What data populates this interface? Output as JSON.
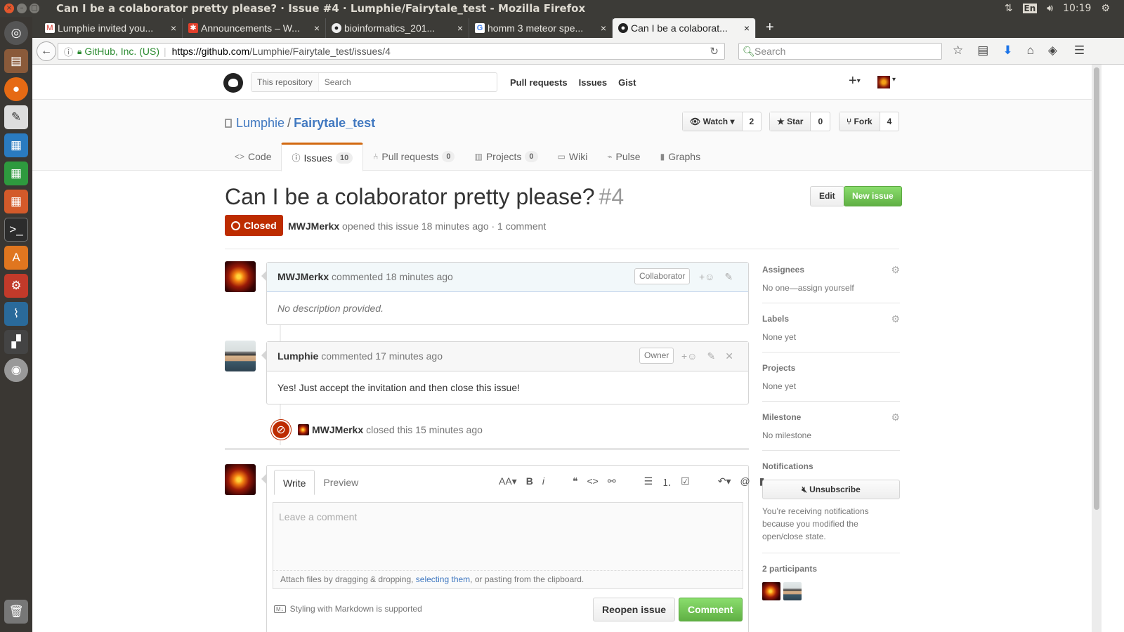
{
  "window": {
    "title": "Can I be a colaborator pretty please? · Issue #4 · Lumphie/Fairytale_test - Mozilla Firefox",
    "tray_lang": "En",
    "time": "10:19"
  },
  "tabs": [
    {
      "label": "Lumphie invited you...",
      "favicon": "gmail-icon"
    },
    {
      "label": "Announcements – W...",
      "favicon": "canvas-icon"
    },
    {
      "label": "bioinformatics_201...",
      "favicon": "github-icon"
    },
    {
      "label": "homm 3 meteor spe...",
      "favicon": "google-icon"
    },
    {
      "label": "Can I be a colaborat...",
      "favicon": "github-icon",
      "active": true
    }
  ],
  "navbar": {
    "identity": "GitHub, Inc. (US)",
    "url_prefix": "https://github.com",
    "url_path": "/Lumphie/Fairytale_test/issues/4",
    "search_placeholder": "Search"
  },
  "gh_header": {
    "scope": "This repository",
    "search_placeholder": "Search",
    "nav": [
      "Pull requests",
      "Issues",
      "Gist"
    ],
    "plus": "+"
  },
  "repo": {
    "owner": "Lumphie",
    "name": "Fairytale_test",
    "watch_label": "Watch",
    "watch_count": "2",
    "star_label": "Star",
    "star_count": "0",
    "fork_label": "Fork",
    "fork_count": "4",
    "tabs": [
      {
        "label": "Code",
        "icon": "code-icon"
      },
      {
        "label": "Issues",
        "count": "10",
        "icon": "issue-opened-icon"
      },
      {
        "label": "Pull requests",
        "count": "0",
        "icon": "git-pull-request-icon"
      },
      {
        "label": "Projects",
        "count": "0",
        "icon": "project-icon"
      },
      {
        "label": "Wiki",
        "icon": "book-icon"
      },
      {
        "label": "Pulse",
        "icon": "pulse-icon"
      },
      {
        "label": "Graphs",
        "icon": "graph-icon"
      }
    ]
  },
  "issue": {
    "title": "Can I be a colaborator pretty please?",
    "number": "#4",
    "edit_label": "Edit",
    "new_issue_label": "New issue",
    "state": "Closed",
    "author": "MWJMerkx",
    "opened_text": "opened this issue 18 minutes ago · 1 comment"
  },
  "comments": [
    {
      "author": "MWJMerkx",
      "meta": "commented 18 minutes ago",
      "role": "Collaborator",
      "body": "No description provided."
    },
    {
      "author": "Lumphie",
      "meta": "commented 17 minutes ago",
      "role": "Owner",
      "body": "Yes! Just accept the invitation and then close this issue!"
    }
  ],
  "closed_event": {
    "actor": "MWJMerkx",
    "text": "closed this 15 minutes ago"
  },
  "composer": {
    "write_tab": "Write",
    "preview_tab": "Preview",
    "placeholder": "Leave a comment",
    "attach_before": "Attach files by dragging & dropping, ",
    "attach_link": "selecting them",
    "attach_after": ", or pasting from the clipboard.",
    "markdown_note": "Styling with Markdown is supported",
    "reopen_label": "Reopen issue",
    "comment_label": "Comment"
  },
  "sidebar": {
    "assignees_head": "Assignees",
    "assignees_val": "No one—assign yourself",
    "labels_head": "Labels",
    "labels_val": "None yet",
    "projects_head": "Projects",
    "projects_val": "None yet",
    "milestone_head": "Milestone",
    "milestone_val": "No milestone",
    "notifications_head": "Notifications",
    "unsubscribe_label": "Unsubscribe",
    "notif_note": "You’re receiving notifications because you modified the open/close state.",
    "participants_head": "2 participants"
  },
  "colors": {
    "closed_red": "#bd2c00",
    "link_blue": "#4078c0",
    "green_button": "#60b044",
    "tab_accent": "#d26911"
  }
}
